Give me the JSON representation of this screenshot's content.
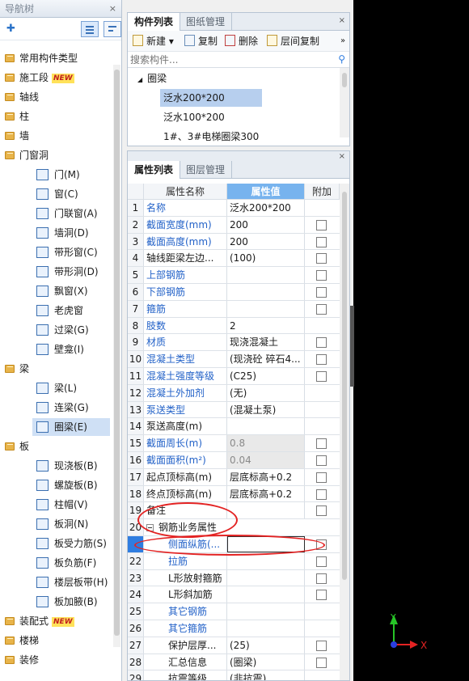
{
  "nav": {
    "title": "导航树",
    "close": "×",
    "add_icon": "add-icon",
    "items": [
      {
        "label": "常用构件类型",
        "type": "folder"
      },
      {
        "label": "施工段",
        "type": "folder",
        "badge": "NEW"
      },
      {
        "label": "轴线",
        "type": "folder"
      },
      {
        "label": "柱",
        "type": "folder"
      },
      {
        "label": "墙",
        "type": "folder"
      },
      {
        "label": "门窗洞",
        "type": "folder-open"
      },
      {
        "label": "门(M)",
        "type": "leaf"
      },
      {
        "label": "窗(C)",
        "type": "leaf"
      },
      {
        "label": "门联窗(A)",
        "type": "leaf"
      },
      {
        "label": "墙洞(D)",
        "type": "leaf"
      },
      {
        "label": "带形窗(C)",
        "type": "leaf"
      },
      {
        "label": "带形洞(D)",
        "type": "leaf"
      },
      {
        "label": "飘窗(X)",
        "type": "leaf"
      },
      {
        "label": "老虎窗",
        "type": "leaf"
      },
      {
        "label": "过梁(G)",
        "type": "leaf"
      },
      {
        "label": "壁龛(I)",
        "type": "leaf"
      },
      {
        "label": "梁",
        "type": "folder-open"
      },
      {
        "label": "梁(L)",
        "type": "leaf"
      },
      {
        "label": "连梁(G)",
        "type": "leaf"
      },
      {
        "label": "圈梁(E)",
        "type": "leaf",
        "selected": true
      },
      {
        "label": "板",
        "type": "folder-open"
      },
      {
        "label": "现浇板(B)",
        "type": "leaf"
      },
      {
        "label": "螺旋板(B)",
        "type": "leaf"
      },
      {
        "label": "柱帽(V)",
        "type": "leaf"
      },
      {
        "label": "板洞(N)",
        "type": "leaf"
      },
      {
        "label": "板受力筋(S)",
        "type": "leaf"
      },
      {
        "label": "板负筋(F)",
        "type": "leaf"
      },
      {
        "label": "楼层板带(H)",
        "type": "leaf"
      },
      {
        "label": "板加腋(B)",
        "type": "leaf"
      },
      {
        "label": "装配式",
        "type": "folder",
        "badge": "NEW"
      },
      {
        "label": "楼梯",
        "type": "folder"
      },
      {
        "label": "装修",
        "type": "folder"
      }
    ]
  },
  "components": {
    "tabs": [
      "构件列表",
      "图纸管理"
    ],
    "close": "×",
    "toolbar": [
      "新建",
      "复制",
      "删除",
      "层间复制"
    ],
    "toolbar_dropdown": "▾",
    "toolbar_more": "»",
    "search_placeholder": "搜索构件...",
    "group": "圈梁",
    "group_arrow": "◢",
    "items": [
      "泛水200*200",
      "泛水100*200",
      "1#、3#电梯圈梁300"
    ],
    "selected_index": 0
  },
  "properties": {
    "tabs": [
      "属性列表",
      "图层管理"
    ],
    "close": "×",
    "headers": {
      "name": "属性名称",
      "value": "属性值",
      "extra": "附加"
    },
    "rows": [
      {
        "n": "1",
        "name": "名称",
        "value": "泛水200*200",
        "blue": true,
        "check": false
      },
      {
        "n": "2",
        "name": "截面宽度(mm)",
        "value": "200",
        "blue": true,
        "check": true
      },
      {
        "n": "3",
        "name": "截面高度(mm)",
        "value": "200",
        "blue": true,
        "check": true
      },
      {
        "n": "4",
        "name": "轴线距梁左边...",
        "value": "(100)",
        "blue": false,
        "check": true
      },
      {
        "n": "5",
        "name": "上部钢筋",
        "value": "",
        "blue": true,
        "check": true
      },
      {
        "n": "6",
        "name": "下部钢筋",
        "value": "",
        "blue": true,
        "check": true
      },
      {
        "n": "7",
        "name": "箍筋",
        "value": "",
        "blue": true,
        "check": true
      },
      {
        "n": "8",
        "name": "肢数",
        "value": "2",
        "blue": true,
        "check": false
      },
      {
        "n": "9",
        "name": "材质",
        "value": "现浇混凝土",
        "blue": true,
        "check": true
      },
      {
        "n": "10",
        "name": "混凝土类型",
        "value": "(现浇砼 碎石4...",
        "blue": true,
        "check": true
      },
      {
        "n": "11",
        "name": "混凝土强度等级",
        "value": "(C25)",
        "blue": true,
        "check": true
      },
      {
        "n": "12",
        "name": "混凝土外加剂",
        "value": "(无)",
        "blue": true,
        "check": false
      },
      {
        "n": "13",
        "name": "泵送类型",
        "value": "(混凝土泵)",
        "blue": true,
        "check": false
      },
      {
        "n": "14",
        "name": "泵送高度(m)",
        "value": "",
        "blue": false,
        "check": false
      },
      {
        "n": "15",
        "name": "截面周长(m)",
        "value": "0.8",
        "blue": true,
        "check": true,
        "disabled": true
      },
      {
        "n": "16",
        "name": "截面面积(m²)",
        "value": "0.04",
        "blue": true,
        "check": true,
        "disabled": true
      },
      {
        "n": "17",
        "name": "起点顶标高(m)",
        "value": "层底标高+0.2",
        "blue": false,
        "check": true
      },
      {
        "n": "18",
        "name": "终点顶标高(m)",
        "value": "层底标高+0.2",
        "blue": false,
        "check": true
      },
      {
        "n": "19",
        "name": "备注",
        "value": "",
        "blue": false,
        "check": true
      },
      {
        "n": "20",
        "name": "钢筋业务属性",
        "value": "",
        "group": true
      },
      {
        "n": "",
        "name": "侧面纵筋(...",
        "value": "",
        "blue": true,
        "check": true,
        "indent": true,
        "active": true
      },
      {
        "n": "22",
        "name": "拉筋",
        "value": "",
        "blue": true,
        "check": true,
        "indent": true
      },
      {
        "n": "23",
        "name": "L形放射箍筋",
        "value": "",
        "blue": false,
        "check": true,
        "indent": true
      },
      {
        "n": "24",
        "name": "L形斜加筋",
        "value": "",
        "blue": false,
        "check": true,
        "indent": true
      },
      {
        "n": "25",
        "name": "其它钢筋",
        "value": "",
        "blue": true,
        "check": false,
        "indent": true
      },
      {
        "n": "26",
        "name": "其它箍筋",
        "value": "",
        "blue": true,
        "check": false,
        "indent": true
      },
      {
        "n": "27",
        "name": "保护层厚...",
        "value": "(25)",
        "blue": false,
        "check": true,
        "indent": true
      },
      {
        "n": "28",
        "name": "汇总信息",
        "value": "(圈梁)",
        "blue": false,
        "check": true,
        "indent": true
      },
      {
        "n": "29",
        "name": "抗震等级",
        "value": "(非抗震)",
        "blue": false,
        "check": false,
        "indent": true
      }
    ]
  },
  "axis": {
    "y": "Y",
    "x": "X"
  },
  "colors": {
    "blue_text": "#2362c8",
    "header_value_bg": "#77b3ee",
    "highlight_ring": "#e32323",
    "axis_x": "#e32323",
    "axis_y": "#27c427"
  }
}
